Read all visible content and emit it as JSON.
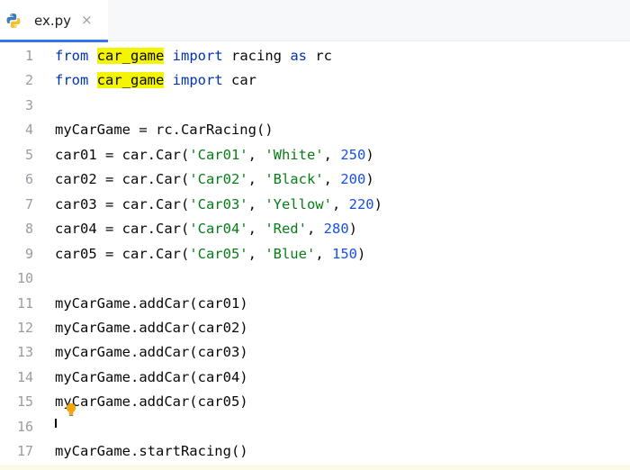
{
  "tab": {
    "filename": "ex.py",
    "close_glyph": "×",
    "icon": "python-icon"
  },
  "colors": {
    "keyword": "#0033b3",
    "string": "#067d17",
    "number": "#1750eb",
    "highlight": "#f4f500",
    "line_number": "#999ca3",
    "tab_accent": "#3574f0"
  },
  "code": {
    "lines": [
      {
        "n": "1",
        "tokens": [
          {
            "t": "from",
            "c": "kw"
          },
          {
            "t": " "
          },
          {
            "t": "car_game",
            "c": "hl"
          },
          {
            "t": " "
          },
          {
            "t": "import",
            "c": "kw"
          },
          {
            "t": " racing "
          },
          {
            "t": "as",
            "c": "kw"
          },
          {
            "t": " rc"
          }
        ]
      },
      {
        "n": "2",
        "tokens": [
          {
            "t": "from",
            "c": "kw"
          },
          {
            "t": " "
          },
          {
            "t": "car_game",
            "c": "hl"
          },
          {
            "t": " "
          },
          {
            "t": "import",
            "c": "kw"
          },
          {
            "t": " car"
          }
        ]
      },
      {
        "n": "3",
        "tokens": []
      },
      {
        "n": "4",
        "tokens": [
          {
            "t": "myCarGame = rc.CarRacing()"
          }
        ]
      },
      {
        "n": "5",
        "tokens": [
          {
            "t": "car01 = car.Car("
          },
          {
            "t": "'Car01'",
            "c": "str"
          },
          {
            "t": ", "
          },
          {
            "t": "'White'",
            "c": "str"
          },
          {
            "t": ", "
          },
          {
            "t": "250",
            "c": "num"
          },
          {
            "t": ")"
          }
        ]
      },
      {
        "n": "6",
        "tokens": [
          {
            "t": "car02 = car.Car("
          },
          {
            "t": "'Car02'",
            "c": "str"
          },
          {
            "t": ", "
          },
          {
            "t": "'Black'",
            "c": "str"
          },
          {
            "t": ", "
          },
          {
            "t": "200",
            "c": "num"
          },
          {
            "t": ")"
          }
        ]
      },
      {
        "n": "7",
        "tokens": [
          {
            "t": "car03 = car.Car("
          },
          {
            "t": "'Car03'",
            "c": "str"
          },
          {
            "t": ", "
          },
          {
            "t": "'Yellow'",
            "c": "str"
          },
          {
            "t": ", "
          },
          {
            "t": "220",
            "c": "num"
          },
          {
            "t": ")"
          }
        ]
      },
      {
        "n": "8",
        "tokens": [
          {
            "t": "car04 = car.Car("
          },
          {
            "t": "'Car04'",
            "c": "str"
          },
          {
            "t": ", "
          },
          {
            "t": "'Red'",
            "c": "str"
          },
          {
            "t": ", "
          },
          {
            "t": "280",
            "c": "num"
          },
          {
            "t": ")"
          }
        ]
      },
      {
        "n": "9",
        "tokens": [
          {
            "t": "car05 = car.Car("
          },
          {
            "t": "'Car05'",
            "c": "str"
          },
          {
            "t": ", "
          },
          {
            "t": "'Blue'",
            "c": "str"
          },
          {
            "t": ", "
          },
          {
            "t": "150",
            "c": "num"
          },
          {
            "t": ")"
          }
        ]
      },
      {
        "n": "10",
        "tokens": []
      },
      {
        "n": "11",
        "tokens": [
          {
            "t": "myCarGame.addCar(car01)"
          }
        ]
      },
      {
        "n": "12",
        "tokens": [
          {
            "t": "myCarGame.addCar(car02)"
          }
        ]
      },
      {
        "n": "13",
        "tokens": [
          {
            "t": "myCarGame.addCar(car03)"
          }
        ]
      },
      {
        "n": "14",
        "tokens": [
          {
            "t": "myCarGame.addCar(car04)"
          }
        ]
      },
      {
        "n": "15",
        "tokens": [
          {
            "t": "myCarGame.addCar(car05)"
          }
        ]
      },
      {
        "n": "16",
        "tokens": []
      },
      {
        "n": "17",
        "tokens": [
          {
            "t": "myCarGame.startRacing()"
          }
        ]
      }
    ]
  },
  "gutter_icon": "lightbulb-icon"
}
